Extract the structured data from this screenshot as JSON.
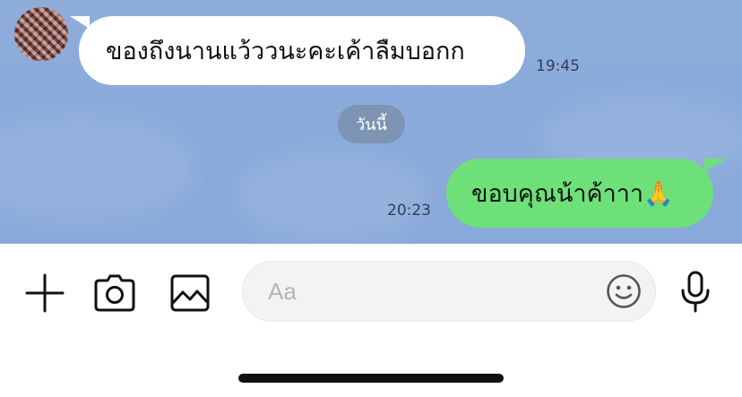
{
  "conversation": {
    "incoming": {
      "text": "ของถึงนานแว้ววนะคะเค้าลืมบอกก",
      "time": "19:45",
      "avatar": "contact-avatar-photo"
    },
    "date_separator": "วันนี้",
    "outgoing": {
      "text": "ขอบคุณน้าค้าาา🙏",
      "time": "20:23"
    }
  },
  "toolbar": {
    "add_icon": "plus-icon",
    "camera_icon": "camera-icon",
    "gallery_icon": "image-icon",
    "input_placeholder": "Aa",
    "input_value": "",
    "emoji_icon": "smiley-icon",
    "mic_icon": "microphone-icon"
  },
  "colors": {
    "chat_background": "#8eadd9",
    "incoming_bubble": "#ffffff",
    "outgoing_bubble": "#6ee07a",
    "date_pill": "#7f92ab",
    "icon": "#111111"
  }
}
